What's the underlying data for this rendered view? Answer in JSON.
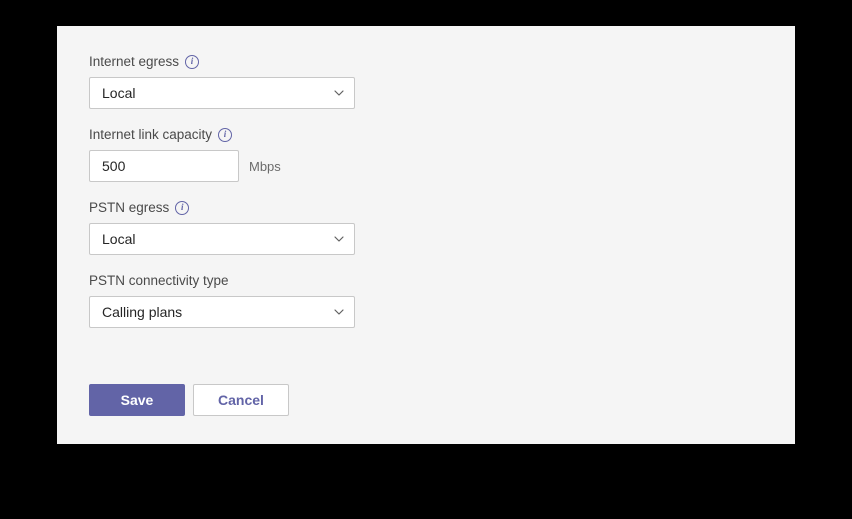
{
  "fields": {
    "internet_egress": {
      "label": "Internet egress",
      "value": "Local"
    },
    "internet_link_capacity": {
      "label": "Internet link capacity",
      "value": "500",
      "unit": "Mbps"
    },
    "pstn_egress": {
      "label": "PSTN egress",
      "value": "Local"
    },
    "pstn_connectivity_type": {
      "label": "PSTN connectivity type",
      "value": "Calling plans"
    }
  },
  "buttons": {
    "save": "Save",
    "cancel": "Cancel"
  }
}
